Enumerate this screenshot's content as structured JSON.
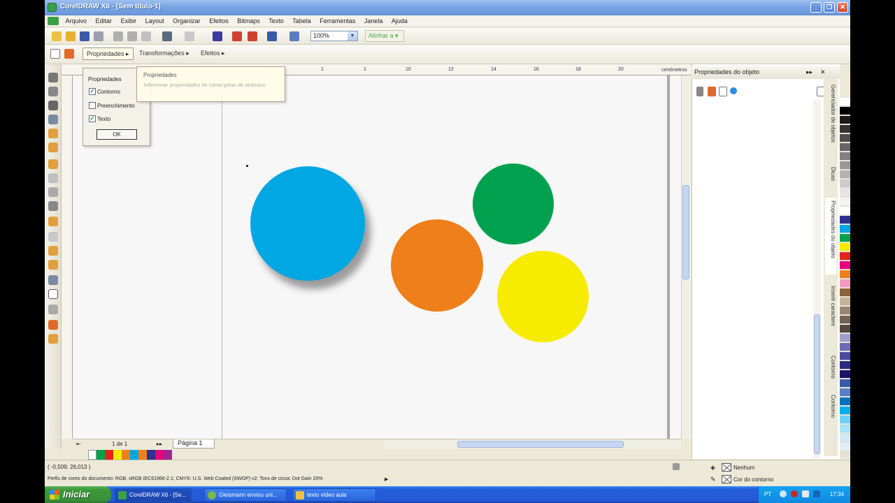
{
  "window": {
    "title": "CorelDRAW X6 - [Sem título-1]"
  },
  "menu": [
    "Arquivo",
    "Editar",
    "Exibir",
    "Layout",
    "Organizar",
    "Efeitos",
    "Bitmaps",
    "Texto",
    "Tabela",
    "Ferramentas",
    "Janela",
    "Ajuda"
  ],
  "toolbar": {
    "zoom": "100%",
    "snap": "Alinhar a"
  },
  "property_bar": {
    "properties": "Propriedades",
    "transforms": "Transformações",
    "effects": "Efeitos"
  },
  "ruler": {
    "h_ticks": [
      "1",
      "1",
      "10",
      "12",
      "14",
      "16",
      "18",
      "20"
    ],
    "unit": "centímetros"
  },
  "popup": {
    "title": "Propriedades",
    "options": [
      {
        "label": "Contorno",
        "checked": true
      },
      {
        "label": "Preenchimento",
        "checked": false
      },
      {
        "label": "Texto",
        "checked": true
      }
    ],
    "ok": "OK"
  },
  "tooltip": {
    "title": "Propriedades",
    "body": "Selecionar propriedades do conta-gotas de atributos."
  },
  "shapes": [
    {
      "name": "blue-circle",
      "color": "#00a7e3",
      "shadow": true
    },
    {
      "name": "orange-circle",
      "color": "#ee7f1a"
    },
    {
      "name": "green-circle",
      "color": "#00a14e"
    },
    {
      "name": "yellow-circle",
      "color": "#f7ec00"
    }
  ],
  "pagenav": {
    "count": "1 de 1",
    "page_tab": "Página 1"
  },
  "palette_row": [
    "#ffffff",
    "#00a14e",
    "#e2231a",
    "#f7ec00",
    "#ee7f1a",
    "#00a7e3",
    "#ee7f1a",
    "#2e3192",
    "#e6007e",
    "#a3238e"
  ],
  "palette_col": [
    "#ffffff",
    "#000000",
    "#1a1a1a",
    "#333333",
    "#4d4d4d",
    "#666666",
    "#808080",
    "#999999",
    "#b3b3b3",
    "#cccccc",
    "#e6e6e6",
    "#f2f2f2",
    "#ffffff",
    "#2e3192",
    "#00a7e3",
    "#00a14e",
    "#f7ec00",
    "#e2231a",
    "#e6007e",
    "#ee7f1a",
    "#f49ac1",
    "#8c6239",
    "#c7b299",
    "#998675",
    "#736357",
    "#534741",
    "#9e9dcc",
    "#6b6bb3",
    "#4a4a9c",
    "#2b2b80",
    "#1b1464",
    "#3a5aa8",
    "#5a7ec4",
    "#0072bc",
    "#00aeef",
    "#6dcff6",
    "#a8e1f8",
    "#cfe9f5",
    "#e0eef5"
  ],
  "docker": {
    "title": "Propriedades do objeto"
  },
  "docker_tabs": [
    "Gerenciador de objetos",
    "Dicas",
    "Propriedades do objeto",
    "Inserir caractere",
    "Contorno",
    "Contorno"
  ],
  "status": {
    "coords": "( -0,509; 26,013 )",
    "profile": "Perfis de cores do documento: RGB: sRGB IEC61966-2.1; CMYK: U.S. Web Coated (SWOP) v2; Tons de cinza: Dot Gain 20%",
    "fill": "Nenhum",
    "outline": "Cor do contorno"
  },
  "taskbar": {
    "start": "Iniciar",
    "tasks": [
      "CorelDRAW X6 - [Se...",
      "Gleismann enviou uni...",
      "texto vídeo aula"
    ],
    "lang": "PT",
    "clock": "17:34"
  }
}
